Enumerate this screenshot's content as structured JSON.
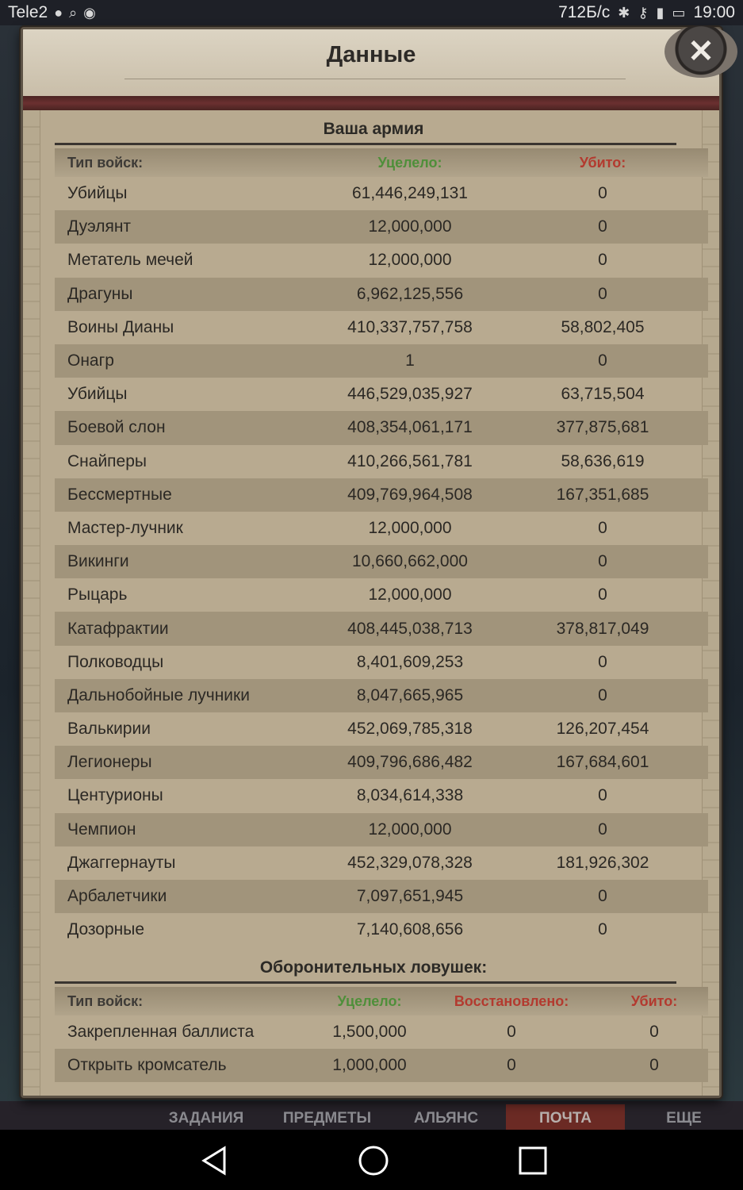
{
  "status_bar": {
    "carrier": "Tele2",
    "speed": "712Б/с",
    "time": "19:00"
  },
  "dialog": {
    "title": "Данные",
    "close_label": "✕"
  },
  "army": {
    "title": "Ваша армия",
    "headers": {
      "type": "Тип войск:",
      "survived": "Уцелело:",
      "killed": "Убито:"
    },
    "rows": [
      {
        "name": "Убийцы",
        "survived": "61,446,249,131",
        "killed": "0"
      },
      {
        "name": "Дуэлянт",
        "survived": "12,000,000",
        "killed": "0"
      },
      {
        "name": "Метатель мечей",
        "survived": "12,000,000",
        "killed": "0"
      },
      {
        "name": "Драгуны",
        "survived": "6,962,125,556",
        "killed": "0"
      },
      {
        "name": "Воины Дианы",
        "survived": "410,337,757,758",
        "killed": "58,802,405"
      },
      {
        "name": "Онагр",
        "survived": "1",
        "killed": "0"
      },
      {
        "name": "Убийцы",
        "survived": "446,529,035,927",
        "killed": "63,715,504"
      },
      {
        "name": "Боевой слон",
        "survived": "408,354,061,171",
        "killed": "377,875,681"
      },
      {
        "name": "Снайперы",
        "survived": "410,266,561,781",
        "killed": "58,636,619"
      },
      {
        "name": "Бессмертные",
        "survived": "409,769,964,508",
        "killed": "167,351,685"
      },
      {
        "name": "Мастер-лучник",
        "survived": "12,000,000",
        "killed": "0"
      },
      {
        "name": "Викинги",
        "survived": "10,660,662,000",
        "killed": "0"
      },
      {
        "name": "Рыцарь",
        "survived": "12,000,000",
        "killed": "0"
      },
      {
        "name": "Катафрактии",
        "survived": "408,445,038,713",
        "killed": "378,817,049"
      },
      {
        "name": "Полководцы",
        "survived": "8,401,609,253",
        "killed": "0"
      },
      {
        "name": "Дальнобойные лучники",
        "survived": "8,047,665,965",
        "killed": "0"
      },
      {
        "name": "Валькирии",
        "survived": "452,069,785,318",
        "killed": "126,207,454"
      },
      {
        "name": "Легионеры",
        "survived": "409,796,686,482",
        "killed": "167,684,601"
      },
      {
        "name": "Центурионы",
        "survived": "8,034,614,338",
        "killed": "0"
      },
      {
        "name": "Чемпион",
        "survived": "12,000,000",
        "killed": "0"
      },
      {
        "name": "Джаггернауты",
        "survived": "452,329,078,328",
        "killed": "181,926,302"
      },
      {
        "name": "Арбалетчики",
        "survived": "7,097,651,945",
        "killed": "0"
      },
      {
        "name": "Дозорные",
        "survived": "7,140,608,656",
        "killed": "0"
      }
    ]
  },
  "traps": {
    "title": "Оборонительных ловушек:",
    "headers": {
      "type": "Тип войск:",
      "survived": "Уцелело:",
      "restored": "Восстановлено:",
      "killed": "Убито:"
    },
    "rows": [
      {
        "name": "Закрепленная баллиста",
        "survived": "1,500,000",
        "restored": "0",
        "killed": "0"
      },
      {
        "name": "Открыть кромсатель",
        "survived": "1,000,000",
        "restored": "0",
        "killed": "0"
      }
    ]
  },
  "game_tabs": [
    {
      "label": "ЗАДАНИЯ"
    },
    {
      "label": "ПРЕДМЕТЫ"
    },
    {
      "label": "АЛЬЯНС"
    },
    {
      "label": "ПОЧТА"
    },
    {
      "label": "ЕЩЕ"
    }
  ],
  "colors": {
    "survived": "#4f8f3a",
    "killed": "#b33a2f",
    "active_tab": "#6b2a24"
  }
}
